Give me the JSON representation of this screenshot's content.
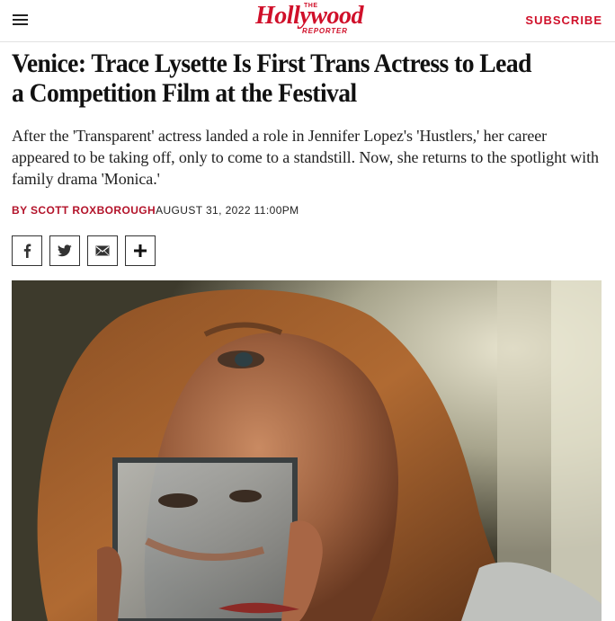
{
  "header": {
    "logo_the": "THE",
    "logo_main": "Hollywood",
    "logo_reporter": "REPORTER",
    "subscribe_label": "SUBSCRIBE",
    "brand_color": "#d0102a"
  },
  "article": {
    "headline": "Venice: Trace Lysette Is First Trans Actress to Lead a Competition Film at the Festival",
    "dek": "After the 'Transparent' actress landed a role in Jennifer Lopez's 'Hustlers,' her career appeared to be taking off, only to come to a standstill. Now, she returns to the spotlight with family drama 'Monica.'",
    "byline_author": "BY SCOTT ROXBOROUGH",
    "byline_date": "AUGUST 31, 2022 11:00PM"
  },
  "share": {
    "buttons": [
      {
        "icon": "facebook-icon"
      },
      {
        "icon": "twitter-icon"
      },
      {
        "icon": "email-icon"
      },
      {
        "icon": "plus-icon"
      }
    ]
  },
  "hero": {
    "description_icon": "photo"
  }
}
